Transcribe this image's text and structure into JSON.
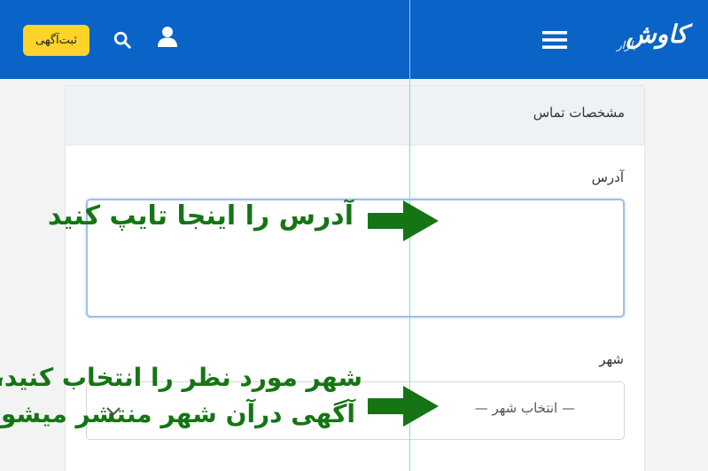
{
  "header": {
    "post_ad_label": "ثبت‌آگهی",
    "logo_text": "کاوش",
    "logo_subtext": "بازار",
    "icons": [
      "search-icon",
      "user-icon",
      "menu-icon"
    ],
    "background_color": "#0a63c7",
    "button_color": "#ffd32a"
  },
  "card": {
    "title": "مشخصات تماس",
    "address_label": "آدرس",
    "address_value": "",
    "city_label": "شهر",
    "city_placeholder": "— انتخاب شهر —"
  },
  "annotations": {
    "address_hint": "آدرس را اینجا تایپ کنید",
    "city_hint_line1": "شهر مورد نظر را انتخاب کنید،",
    "city_hint_line2": "آگهی درآن شهر منتشر میشود",
    "color": "#157514"
  }
}
